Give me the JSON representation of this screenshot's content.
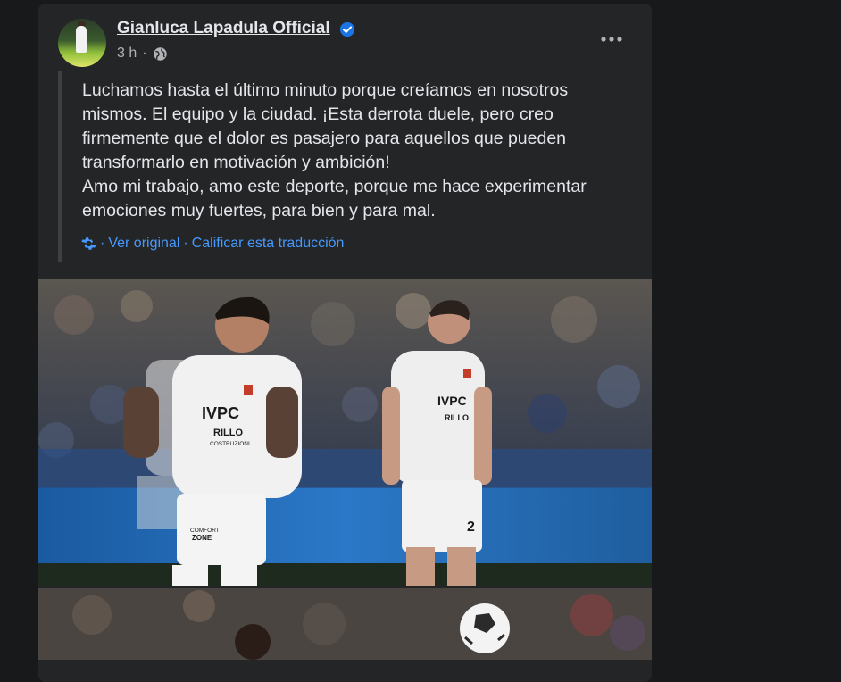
{
  "post": {
    "author": "Gianluca Lapadula Official",
    "time": "3 h",
    "text": "Luchamos hasta el último minuto porque creíamos en nosotros\nmismos. El equipo y la ciudad. ¡Esta derrota duele, pero creo\nfirmemente que el dolor es pasajero para aquellos que pueden\ntransformarlo en motivación y ambición!\nAmo mi trabajo, amo este deporte, porque me hace experimentar\nemociones muy fuertes, para bien y para mal.",
    "translation": {
      "sep1": "·",
      "see_original": "Ver original",
      "sep2": "·",
      "rate": "Calificar esta traducción"
    },
    "photo1": {
      "player_left": {
        "sponsor": "IVPC",
        "sponsor_sub": "RILLO",
        "sponsor_sub2": "COSTRUZIONI",
        "shorts_logo_line1": "COMFORT",
        "shorts_logo_line2": "ZONE"
      },
      "player_right": {
        "sponsor": "IVPC",
        "sponsor_sub": "RILLO",
        "shorts_number": "2"
      }
    }
  },
  "colors": {
    "background": "#18191a",
    "card": "#242526",
    "text_primary": "#e4e6eb",
    "text_secondary": "#b0b3b8",
    "link": "#4599ff",
    "verified": "#1b74e4"
  },
  "icons": {
    "verified": "verified-badge-icon",
    "audience": "globe-icon",
    "more": "more-options-icon",
    "translate": "gear-icon"
  }
}
